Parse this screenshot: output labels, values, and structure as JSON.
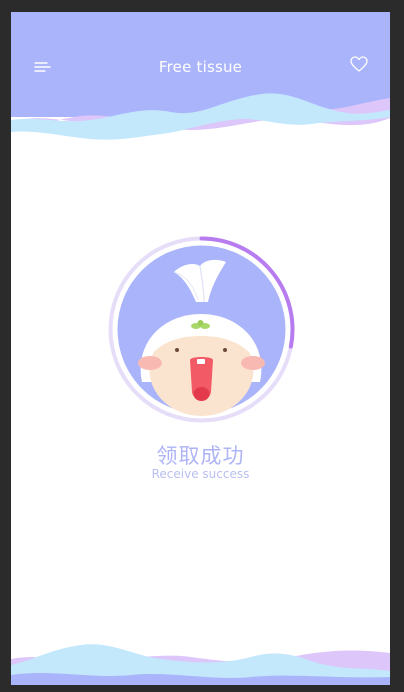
{
  "header": {
    "title": "Free tissue",
    "menu_icon": "hamburger-menu-icon",
    "favorite_icon": "heart-outline-icon"
  },
  "status": {
    "title_cn": "领取成功",
    "title_en": "Receive success",
    "progress": 0.28
  },
  "colors": {
    "brand_purple": "#aab4fb",
    "wave_blue": "#c3e7fb",
    "wave_lilac": "#dcc6fa",
    "progress_arc": "#b77cf0",
    "text_accent": "#aeb4f6"
  }
}
